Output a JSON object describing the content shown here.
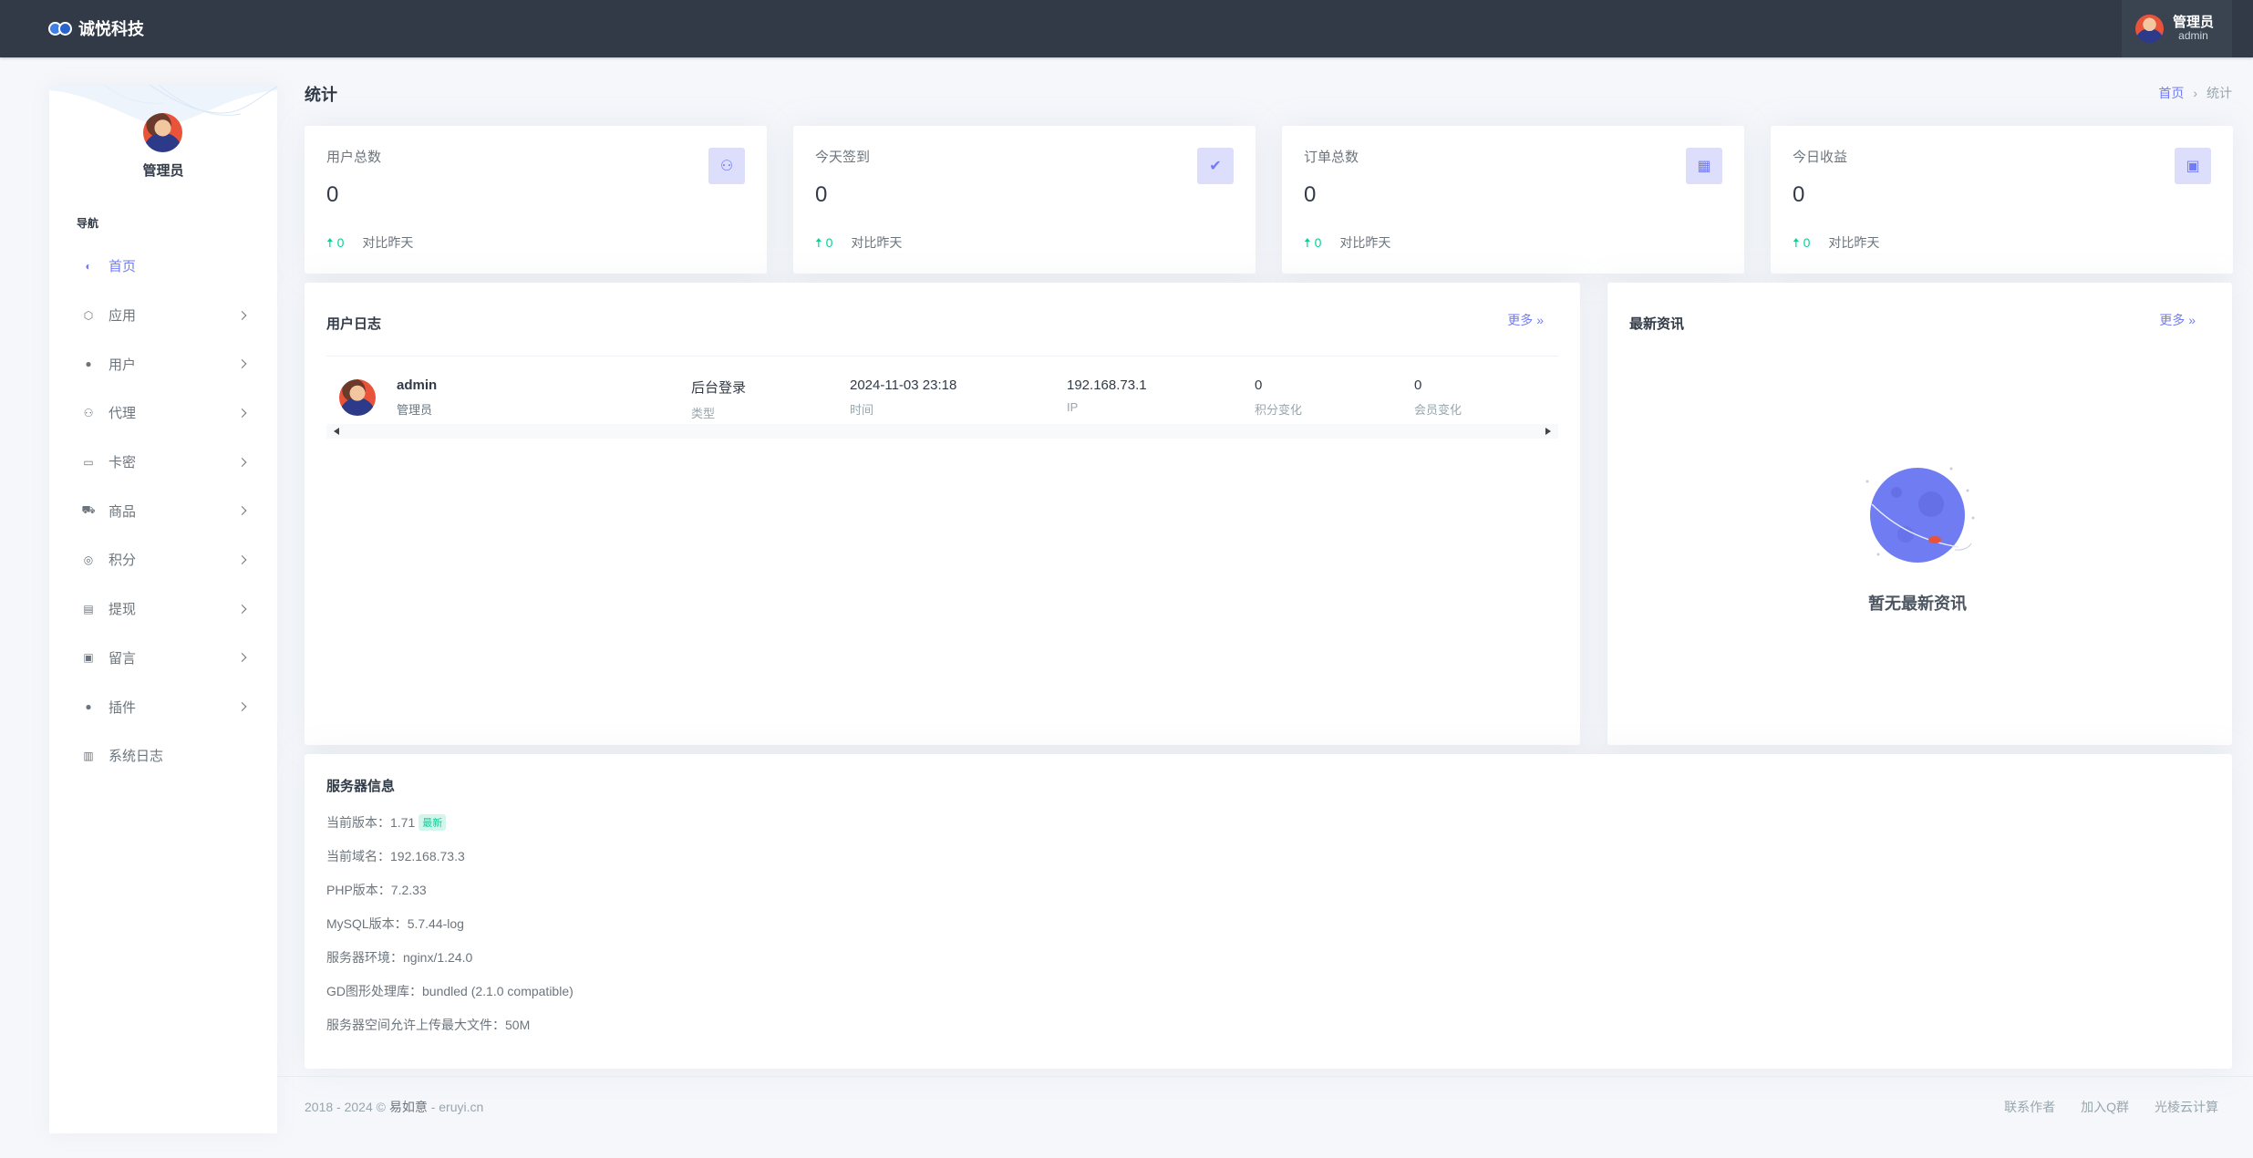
{
  "brand": {
    "name": "诚悦科技"
  },
  "topbar": {
    "user_name": "管理员",
    "user_sub": "admin"
  },
  "sidebar": {
    "user_name": "管理员",
    "nav_title": "导航",
    "items": [
      {
        "label": "首页",
        "icon": "home-icon",
        "active": true,
        "has_children": false
      },
      {
        "label": "应用",
        "icon": "box-icon",
        "has_children": true
      },
      {
        "label": "用户",
        "icon": "user-icon",
        "has_children": true
      },
      {
        "label": "代理",
        "icon": "users-icon",
        "has_children": true
      },
      {
        "label": "卡密",
        "icon": "card-icon",
        "has_children": true
      },
      {
        "label": "商品",
        "icon": "cart-icon",
        "has_children": true
      },
      {
        "label": "积分",
        "icon": "coin-icon",
        "has_children": true
      },
      {
        "label": "提现",
        "icon": "withdraw-icon",
        "has_children": true
      },
      {
        "label": "留言",
        "icon": "message-icon",
        "has_children": true
      },
      {
        "label": "插件",
        "icon": "plugin-icon",
        "has_children": true
      },
      {
        "label": "系统日志",
        "icon": "log-icon",
        "has_children": false
      }
    ]
  },
  "header": {
    "title": "统计",
    "breadcrumb": {
      "home": "首页",
      "sep": "›",
      "current": "统计"
    }
  },
  "stats": [
    {
      "label": "用户总数",
      "value": "0",
      "delta": "0",
      "compare": "对比昨天",
      "icon": "users-icon"
    },
    {
      "label": "今天签到",
      "value": "0",
      "delta": "0",
      "compare": "对比昨天",
      "icon": "user-check-icon"
    },
    {
      "label": "订单总数",
      "value": "0",
      "delta": "0",
      "compare": "对比昨天",
      "icon": "calendar-icon"
    },
    {
      "label": "今日收益",
      "value": "0",
      "delta": "0",
      "compare": "对比昨天",
      "icon": "money-icon"
    }
  ],
  "user_log": {
    "title": "用户日志",
    "more": "更多  »",
    "rows": [
      {
        "name": "admin",
        "role": "管理员",
        "type": "后台登录",
        "type_label": "类型",
        "time": "2024-11-03 23:18",
        "time_label": "时间",
        "ip": "192.168.73.1",
        "ip_label": "IP",
        "points": "0",
        "points_label": "积分变化",
        "member": "0",
        "member_label": "会员变化"
      }
    ]
  },
  "news": {
    "title": "最新资讯",
    "more": "更多  »",
    "empty": "暂无最新资讯"
  },
  "server": {
    "title": "服务器信息",
    "version_label": "当前版本：",
    "version": "1.71",
    "version_badge": "最新",
    "domain_label": "当前域名：",
    "domain": "192.168.73.3",
    "php_label": "PHP版本：",
    "php": "7.2.33",
    "mysql_label": "MySQL版本：",
    "mysql": "5.7.44-log",
    "env_label": "服务器环境：",
    "env": "nginx/1.24.0",
    "gd_label": "GD图形处理库：",
    "gd": "bundled (2.1.0 compatible)",
    "upload_label": "服务器空间允许上传最大文件：",
    "upload": "50M"
  },
  "footer": {
    "copyright": "2018 - 2024 © ",
    "author": "易如意",
    "site": " - eruyi.cn",
    "links": [
      "联系作者",
      "加入Q群",
      "光棱云计算"
    ]
  },
  "colors": {
    "topbar": "#313a46",
    "accent": "#727cf5",
    "success": "#0acf97",
    "background": "#f5f7fb"
  }
}
